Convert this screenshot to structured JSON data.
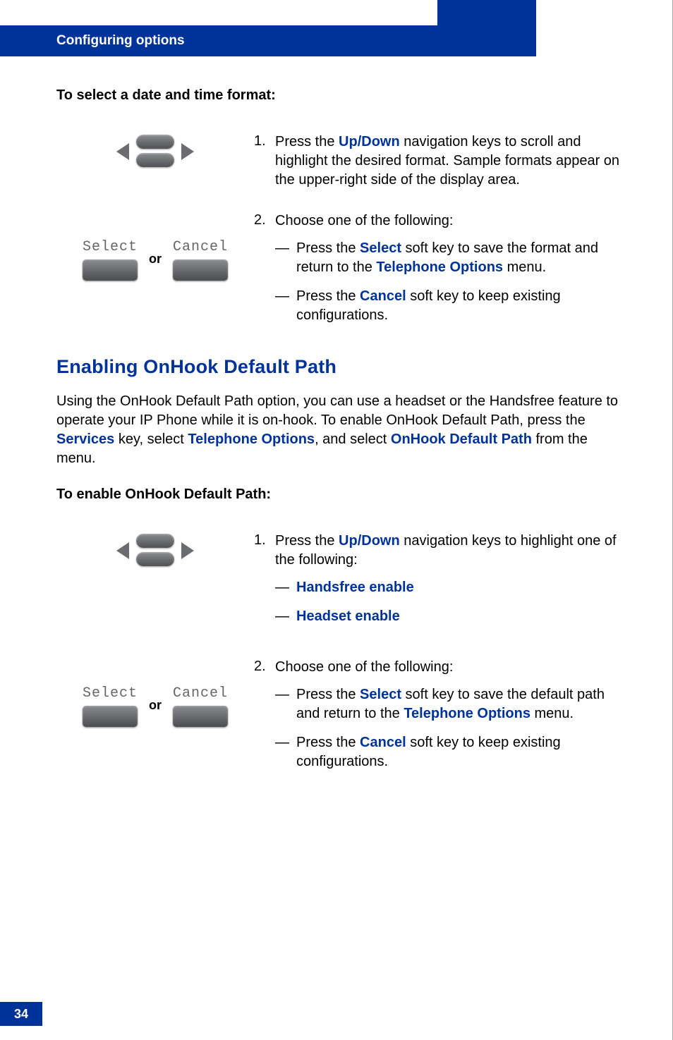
{
  "header": {
    "title": "Configuring options"
  },
  "pageNumber": "34",
  "section1": {
    "heading": "To select a date and time format:",
    "step1": {
      "num": "1.",
      "pre": "Press the ",
      "link": "Up/Down",
      "post": " navigation keys to scroll and highlight the desired format. Sample formats appear on the upper-right side of the display area."
    },
    "step2": {
      "num": "2.",
      "lead": "Choose one of the following:",
      "a": {
        "pre": "Press the ",
        "k1": "Select",
        "mid": " soft key to save the format and return to the ",
        "k2": "Telephone Options",
        "post": " menu."
      },
      "b": {
        "pre": "Press the ",
        "k1": "Cancel",
        "post": " soft key to keep existing configurations."
      }
    }
  },
  "sectionTitle": "Enabling OnHook Default Path",
  "intro": {
    "pre": "Using the OnHook Default Path option, you can use a headset or the Handsfree feature to operate your IP Phone while it is on-hook. To enable OnHook Default Path, press the ",
    "k1": "Services",
    "mid1": " key, select ",
    "k2": "Telephone Options",
    "mid2": ", and select ",
    "k3": "OnHook Default Path",
    "post": " from the menu."
  },
  "section2": {
    "heading": "To enable OnHook Default Path:",
    "step1": {
      "num": "1.",
      "pre": "Press the ",
      "link": "Up/Down",
      "post": " navigation keys to highlight one of the following:",
      "opt1": "Handsfree enable",
      "opt2": "Headset enable"
    },
    "step2": {
      "num": "2.",
      "lead": "Choose one of the following:",
      "a": {
        "pre": "Press the ",
        "k1": "Select",
        "mid": " soft key to save the default path and return to the ",
        "k2": "Telephone Options",
        "post": " menu."
      },
      "b": {
        "pre": "Press the ",
        "k1": "Cancel",
        "post": " soft key to keep existing configurations."
      }
    }
  },
  "softkeys": {
    "select": "Select",
    "cancel": "Cancel",
    "or": "or"
  },
  "dash": "—"
}
